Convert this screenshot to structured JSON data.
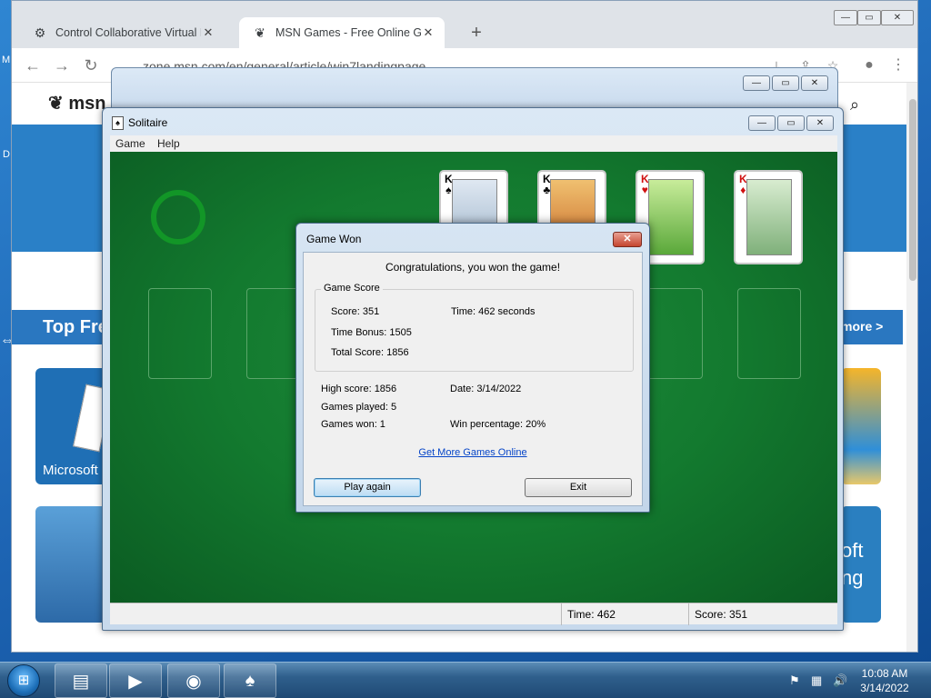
{
  "desktop": {
    "label_m": "M",
    "label_d": "D"
  },
  "browser": {
    "tabs": [
      {
        "title": "Control Collaborative Virtual Ma",
        "icon": "control-icon"
      },
      {
        "title": "MSN Games - Free Online Game",
        "icon": "msn-butterfly-icon"
      }
    ],
    "new_tab": "+",
    "url": "zone.msn.com/en/general/article/win7landingpage",
    "controls": {
      "minimize": "—",
      "maximize": "▭",
      "close": "✕"
    }
  },
  "msn_page": {
    "logo_text": "msn",
    "section_title": "Top Fre",
    "more_link": "more >",
    "tile_microsoft": "Microsoft",
    "tile_right_text_1": "oft",
    "tile_right_text_2": "ng"
  },
  "solitaire": {
    "title": "Solitaire",
    "menu": [
      "Game",
      "Help"
    ],
    "foundations": [
      {
        "rank": "K",
        "suit": "♠",
        "color": "#000000"
      },
      {
        "rank": "K",
        "suit": "♣",
        "color": "#000000"
      },
      {
        "rank": "K",
        "suit": "♥",
        "color": "#d01010"
      },
      {
        "rank": "K",
        "suit": "♦",
        "color": "#d01010"
      }
    ],
    "status": {
      "time": "Time:  462",
      "score": "Score: 351"
    }
  },
  "dialog": {
    "title": "Game Won",
    "close": "✕",
    "congrats": "Congratulations, you won the game!",
    "group_title": "Game Score",
    "score": "Score: 351",
    "time": "Time:  462 seconds",
    "time_bonus": "Time Bonus: 1505",
    "total_score": "Total Score: 1856",
    "high_score": "High score: 1856",
    "date": "Date: 3/14/2022",
    "games_played": "Games played: 5",
    "games_won": "Games won: 1",
    "win_percentage": "Win percentage: 20%",
    "link": "Get More Games Online",
    "play_again": "Play again",
    "exit": "Exit"
  },
  "taskbar": {
    "apps": [
      "explorer-icon",
      "media-player-icon",
      "chrome-icon",
      "solitaire-icon"
    ],
    "time": "10:08 AM",
    "date": "3/14/2022"
  }
}
